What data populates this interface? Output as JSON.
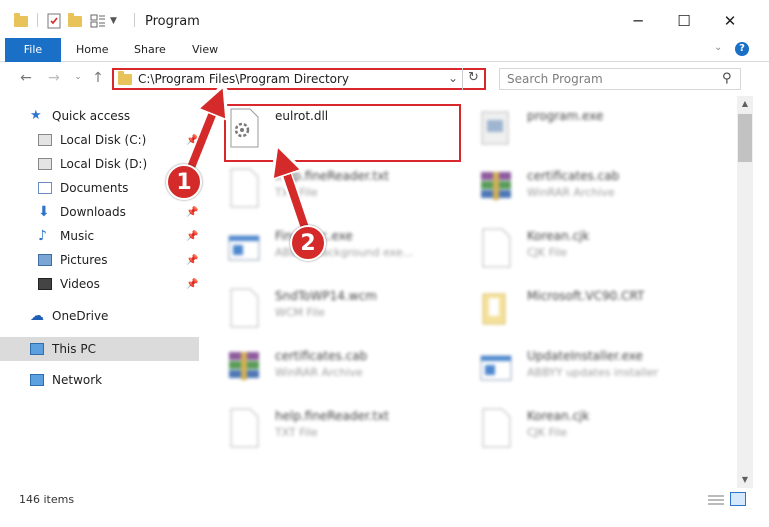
{
  "window": {
    "title": "Program",
    "minimize": "─",
    "maximize": "☐",
    "close": "✕"
  },
  "ribbon": {
    "tabs": [
      "File",
      "Home",
      "Share",
      "View"
    ]
  },
  "address": {
    "path": "C:\\Program Files\\Program Directory",
    "search_placeholder": "Search Program"
  },
  "nav": {
    "items": [
      {
        "label": "Quick access",
        "icon": "star-icon"
      },
      {
        "label": "Local Disk (C:)",
        "icon": "drive-icon",
        "pinned": true
      },
      {
        "label": "Local Disk (D:)",
        "icon": "drive-icon"
      },
      {
        "label": "Documents",
        "icon": "documents-icon",
        "pinned": true
      },
      {
        "label": "Downloads",
        "icon": "download-icon",
        "pinned": true
      },
      {
        "label": "Music",
        "icon": "music-icon",
        "pinned": true
      },
      {
        "label": "Pictures",
        "icon": "pictures-icon",
        "pinned": true
      },
      {
        "label": "Videos",
        "icon": "videos-icon",
        "pinned": true
      },
      {
        "label": "OneDrive",
        "icon": "cloud-icon"
      },
      {
        "label": "This PC",
        "icon": "computer-icon",
        "selected": true
      },
      {
        "label": "Network",
        "icon": "network-icon"
      }
    ]
  },
  "files": [
    {
      "name": "eulrot.dll",
      "type": "",
      "icon": "dll-gear-icon",
      "highlighted": true
    },
    {
      "name": "program.exe",
      "type": "",
      "icon": "exe-icon",
      "blurred": true
    },
    {
      "name": "help.fineReader.txt",
      "type": "TXT File",
      "icon": "text-file-icon",
      "blurred": true
    },
    {
      "name": "certificates.cab",
      "type": "WinRAR Archive",
      "icon": "winrar-icon",
      "blurred": true
    },
    {
      "name": "FineExec.exe",
      "type": "ABBYY Background exe...",
      "icon": "exe-window-icon",
      "blurred": true
    },
    {
      "name": "Korean.cjk",
      "type": "CJK File",
      "icon": "blank-file-icon",
      "blurred": true
    },
    {
      "name": "SndToWP14.wcm",
      "type": "WCM File",
      "icon": "blank-file-icon",
      "blurred": true
    },
    {
      "name": "Microsoft.VC90.CRT",
      "type": "",
      "icon": "folder-icon",
      "blurred": true
    },
    {
      "name": "certificates.cab",
      "type": "WinRAR Archive",
      "icon": "winrar-icon",
      "blurred": true
    },
    {
      "name": "UpdateInstaller.exe",
      "type": "ABBYY updates installer",
      "icon": "exe-window-icon",
      "blurred": true
    },
    {
      "name": "help.fineReader.txt",
      "type": "TXT File",
      "icon": "text-file-icon",
      "blurred": true
    },
    {
      "name": "Korean.cjk",
      "type": "CJK File",
      "icon": "blank-file-icon",
      "blurred": true
    }
  ],
  "status": {
    "item_count": "146 items"
  },
  "callouts": [
    "1",
    "2"
  ],
  "colors": {
    "accent": "#1a6fc6",
    "highlight_red": "#d9282b",
    "callout_red": "#d42a2a"
  }
}
